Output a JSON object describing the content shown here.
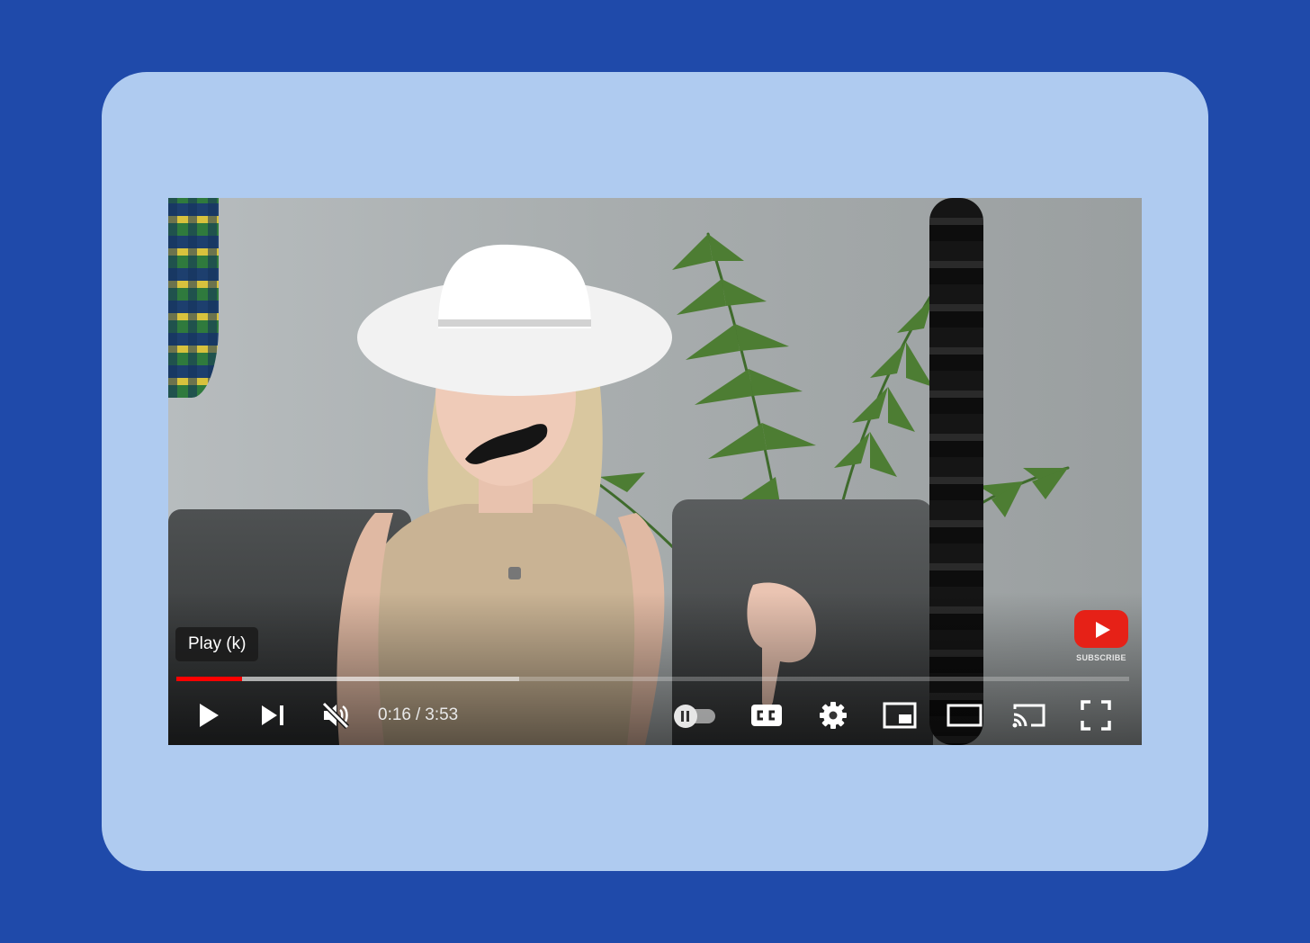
{
  "player": {
    "tooltip": "Play (k)",
    "subscribe_label": "SUBSCRIBE",
    "current_time": "0:16",
    "time_separator": "/",
    "duration": "3:53",
    "progress": {
      "played_fraction": 0.0687,
      "buffered_fraction": 0.36
    },
    "autoplay_on": false,
    "colors": {
      "progress_played": "#ff0000",
      "subscribe_logo": "#e62117",
      "page_background": "#1f4aaa",
      "card_background": "#afcbf0"
    },
    "controls": [
      {
        "id": "play",
        "icon": "play-icon"
      },
      {
        "id": "next",
        "icon": "skip-next-icon"
      },
      {
        "id": "mute",
        "icon": "volume-muted-icon"
      },
      {
        "id": "autoplay",
        "icon": "autoplay-toggle-icon"
      },
      {
        "id": "captions",
        "icon": "closed-captions-icon"
      },
      {
        "id": "settings",
        "icon": "gear-icon"
      },
      {
        "id": "miniplayer",
        "icon": "miniplayer-icon"
      },
      {
        "id": "theater",
        "icon": "theater-mode-icon"
      },
      {
        "id": "cast",
        "icon": "cast-icon"
      },
      {
        "id": "fullscreen",
        "icon": "fullscreen-icon"
      }
    ]
  }
}
